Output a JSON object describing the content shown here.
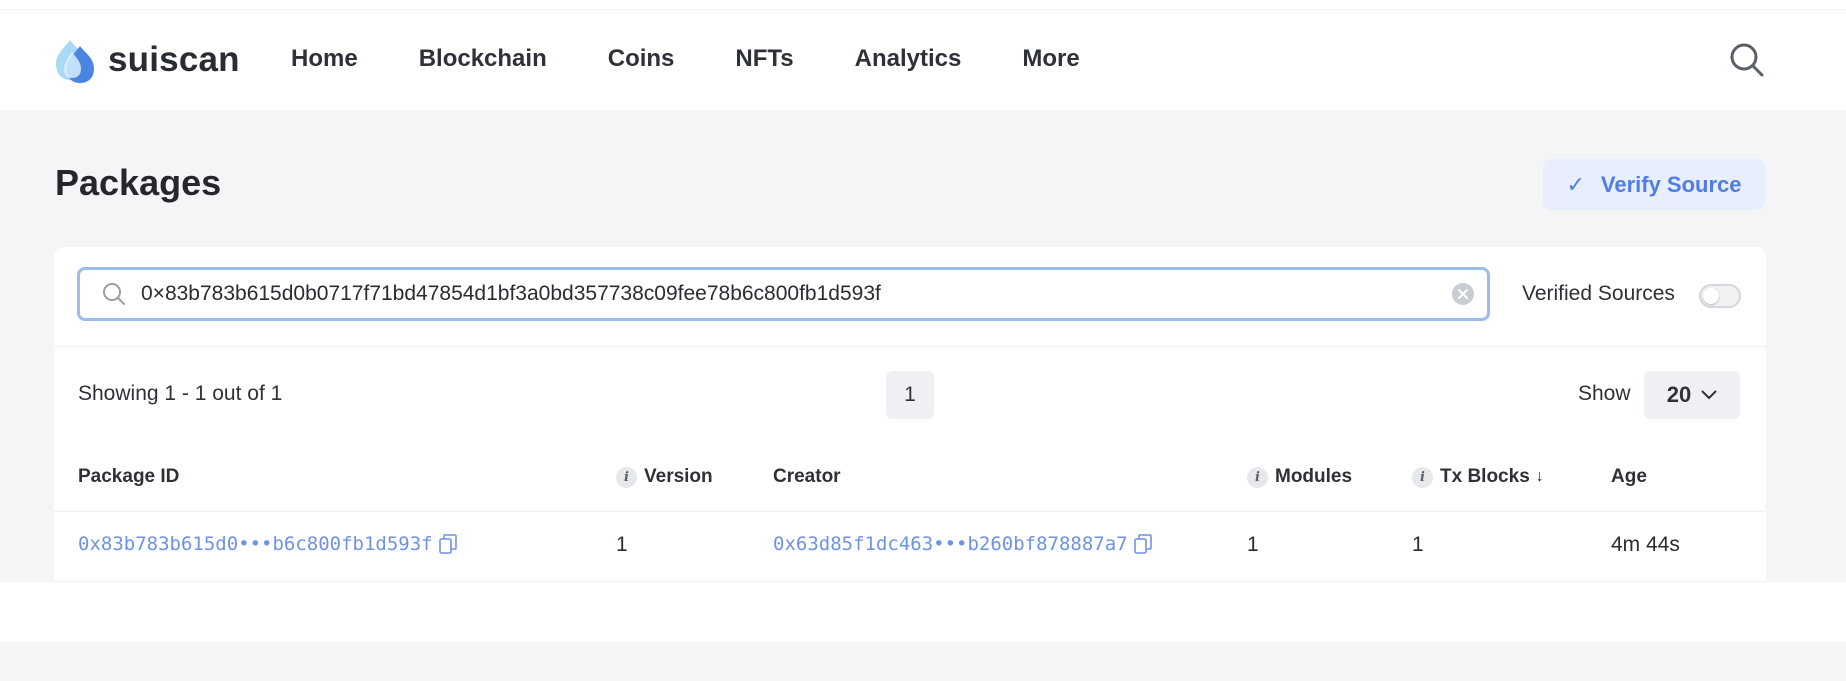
{
  "brand": {
    "name": "suiscan"
  },
  "nav": {
    "items": [
      "Home",
      "Blockchain",
      "Coins",
      "NFTs",
      "Analytics",
      "More"
    ]
  },
  "page": {
    "title": "Packages",
    "verify_label": "Verify Source"
  },
  "search": {
    "value": "0×83b783b615d0b0717f71bd47854d1bf3a0bd357738c09fee78b6c800fb1d593f"
  },
  "filters": {
    "verified_label": "Verified Sources",
    "verified_on": false
  },
  "pagination": {
    "showing": "Showing 1 - 1 out of 1",
    "current_page": "1",
    "show_label": "Show",
    "page_size": "20"
  },
  "table": {
    "headers": {
      "package_id": "Package ID",
      "version": "Version",
      "creator": "Creator",
      "modules": "Modules",
      "tx_blocks": "Tx Blocks",
      "age": "Age"
    },
    "rows": [
      {
        "package_id": "0x83b783b615d0•••b6c800fb1d593f",
        "version": "1",
        "creator": "0x63d85f1dc463•••b260bf878887a7",
        "modules": "1",
        "tx_blocks": "1",
        "age": "4m 44s"
      }
    ]
  },
  "colors": {
    "accent": "#4f7ce8",
    "link": "#6e92e6",
    "focus_border": "#9dbcee",
    "page_bg": "#f4f5f7"
  },
  "icons": {
    "search": "search-icon",
    "verify": "check-icon",
    "clear": "clear-icon",
    "info": "info-icon",
    "sort": "arrow-down-icon",
    "copy": "copy-icon",
    "dropdown": "chevron-down-icon"
  }
}
